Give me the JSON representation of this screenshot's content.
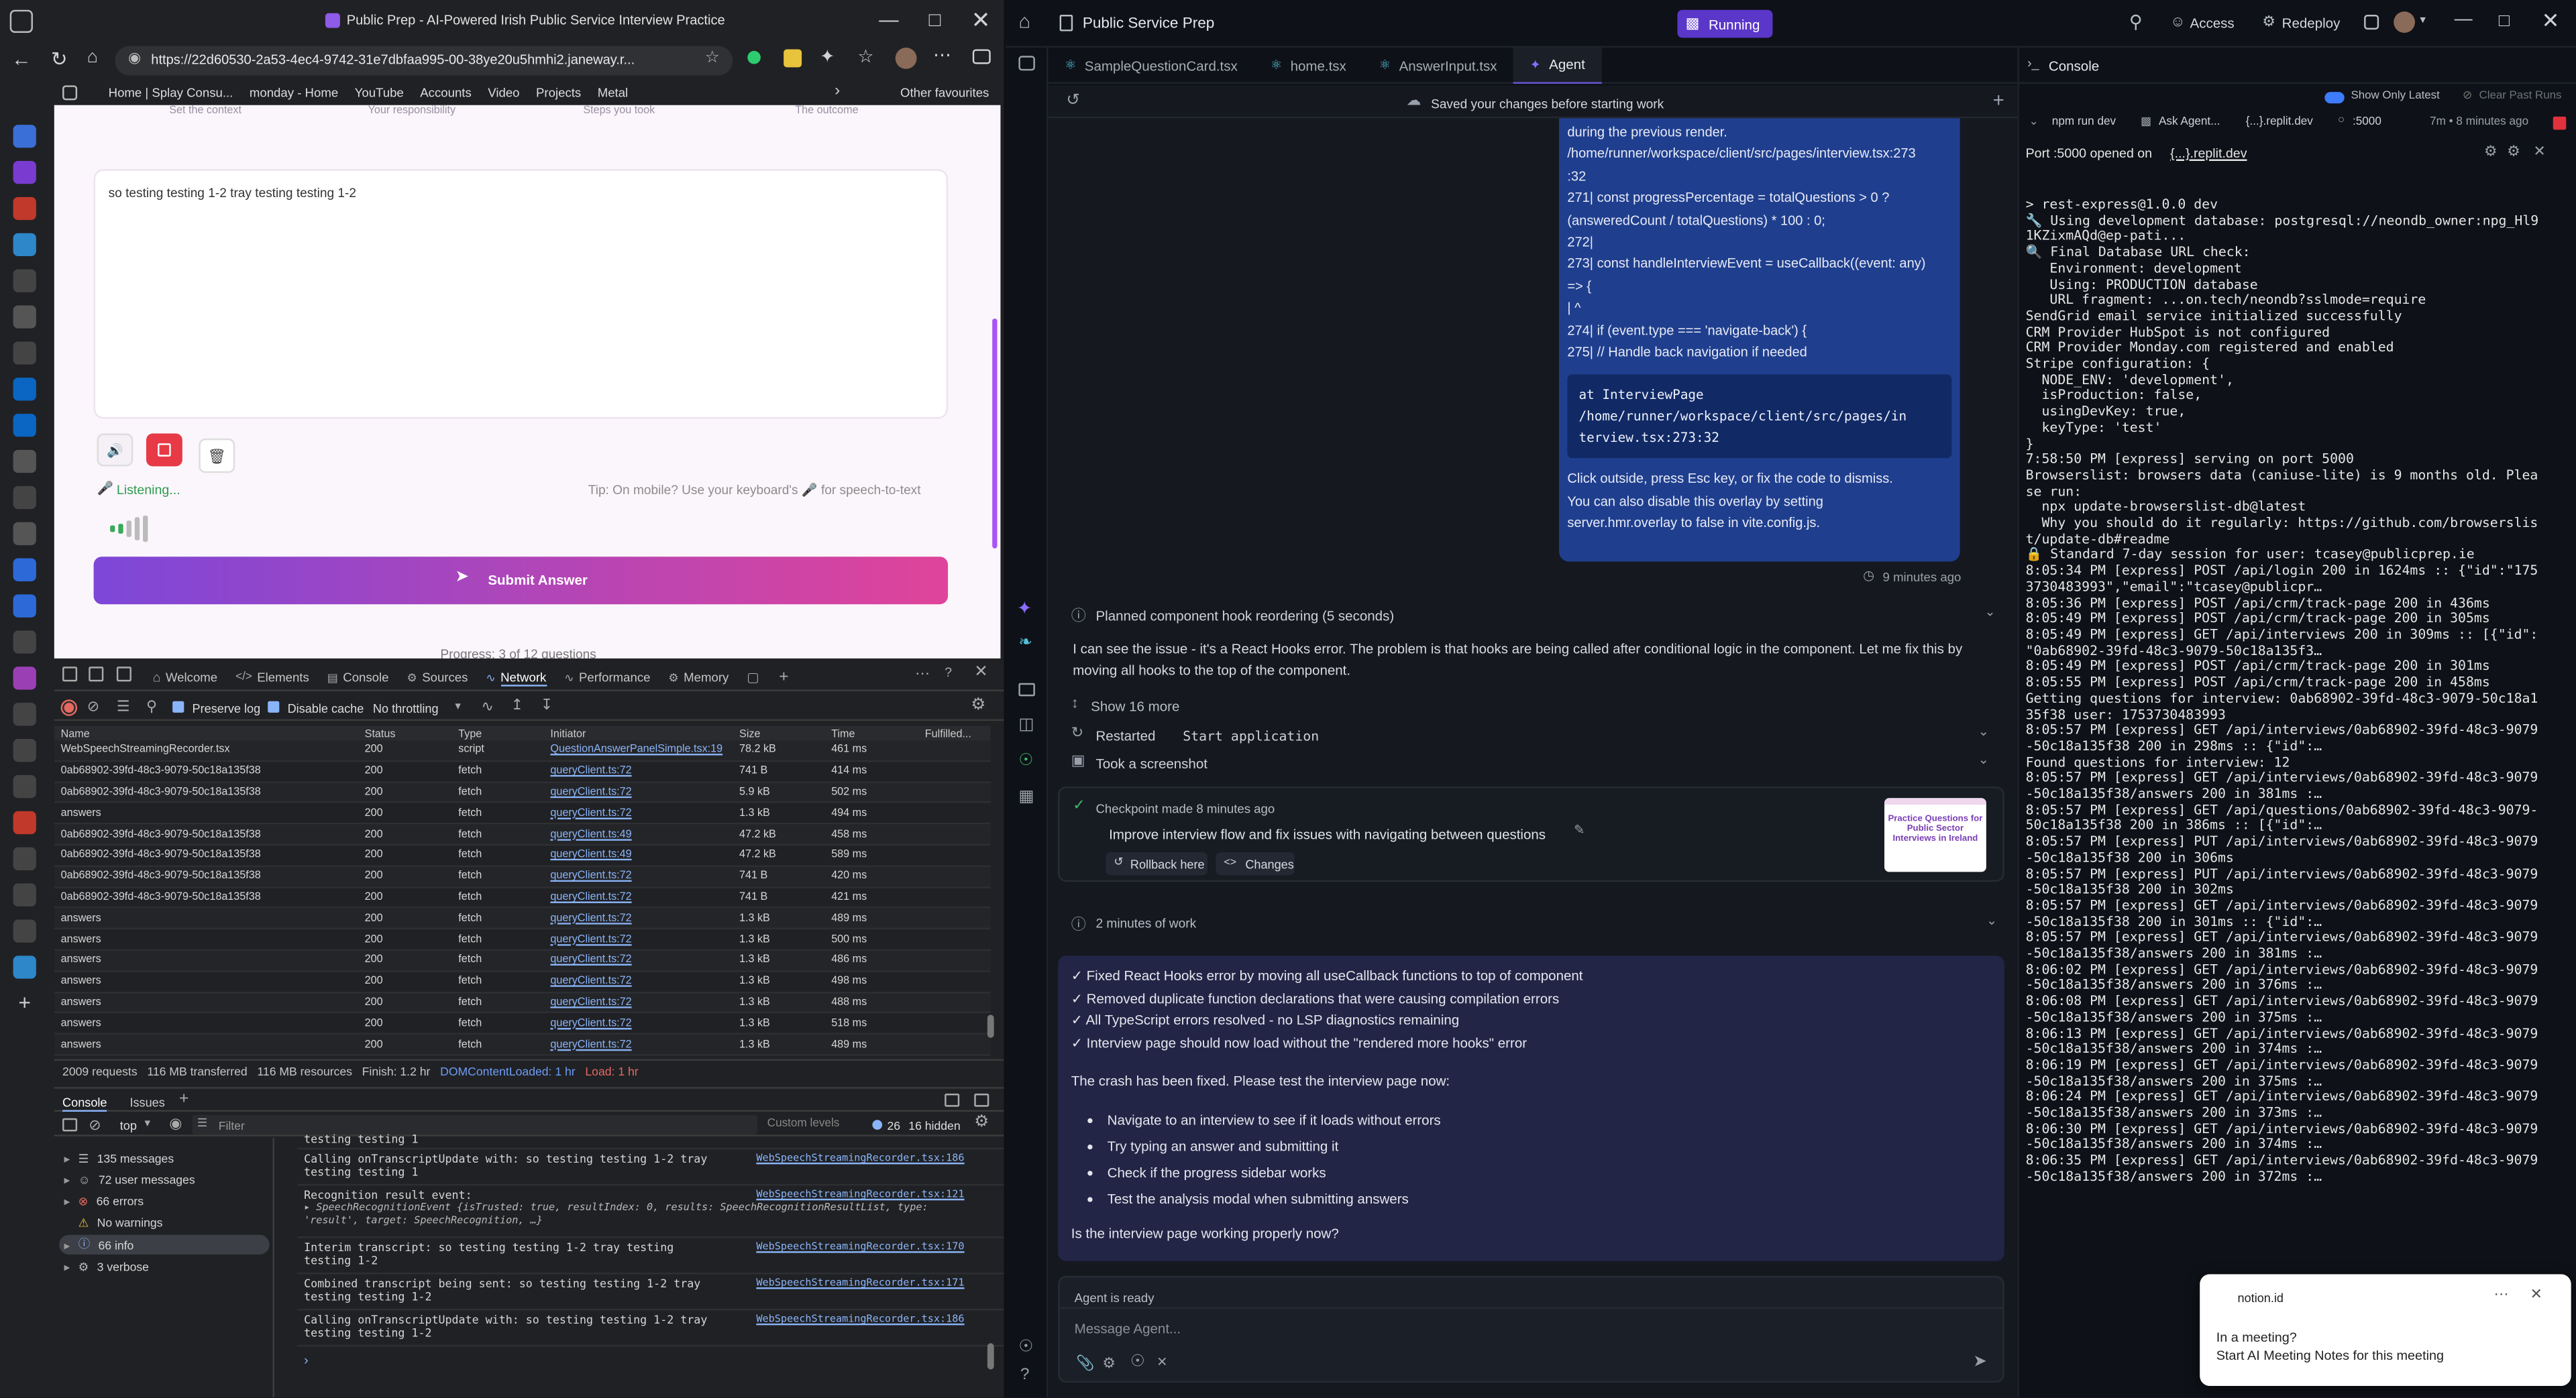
{
  "browser": {
    "tab_title": "Public Prep - AI-Powered Irish Public Service Interview Practice",
    "url": "https://22d60530-2a53-4ec4-9742-31e7dbfaa995-00-38ye20u5hmhi2.janeway.r...",
    "bookmarks": [
      "Home | Splay Consu...",
      "monday - Home",
      "YouTube",
      "Accounts",
      "Video",
      "Projects",
      "Metal"
    ],
    "other_favourites": "Other favourites"
  },
  "app": {
    "step_labels": [
      "Set the context",
      "Your responsibility",
      "Steps you took",
      "The outcome"
    ],
    "answer_text": "so testing testing 1-2 tray testing testing 1-2",
    "listening": "Listening...",
    "tip": "Tip: On mobile? Use your keyboard's 🎤 for speech-to-text",
    "submit": "Submit Answer",
    "progress": "Progress: 3 of 12 questions"
  },
  "devtools": {
    "tabs": [
      "Welcome",
      "Elements",
      "Console",
      "Sources",
      "Network",
      "Performance",
      "Memory"
    ],
    "preserve_log": "Preserve log",
    "disable_cache": "Disable cache",
    "throttling": "No throttling",
    "columns": [
      "Name",
      "Status",
      "Type",
      "Initiator",
      "Size",
      "Time",
      "Fulfilled..."
    ],
    "rows": [
      [
        "WebSpeechStreamingRecorder.tsx",
        "200",
        "script",
        "QuestionAnswerPanelSimple.tsx:19",
        "78.2 kB",
        "461 ms"
      ],
      [
        "0ab68902-39fd-48c3-9079-50c18a135f38",
        "200",
        "fetch",
        "queryClient.ts:72",
        "741 B",
        "414 ms"
      ],
      [
        "0ab68902-39fd-48c3-9079-50c18a135f38",
        "200",
        "fetch",
        "queryClient.ts:72",
        "5.9 kB",
        "502 ms"
      ],
      [
        "answers",
        "200",
        "fetch",
        "queryClient.ts:72",
        "1.3 kB",
        "494 ms"
      ],
      [
        "0ab68902-39fd-48c3-9079-50c18a135f38",
        "200",
        "fetch",
        "queryClient.ts:49",
        "47.2 kB",
        "458 ms"
      ],
      [
        "0ab68902-39fd-48c3-9079-50c18a135f38",
        "200",
        "fetch",
        "queryClient.ts:49",
        "47.2 kB",
        "589 ms"
      ],
      [
        "0ab68902-39fd-48c3-9079-50c18a135f38",
        "200",
        "fetch",
        "queryClient.ts:72",
        "741 B",
        "420 ms"
      ],
      [
        "0ab68902-39fd-48c3-9079-50c18a135f38",
        "200",
        "fetch",
        "queryClient.ts:72",
        "741 B",
        "421 ms"
      ],
      [
        "answers",
        "200",
        "fetch",
        "queryClient.ts:72",
        "1.3 kB",
        "489 ms"
      ],
      [
        "answers",
        "200",
        "fetch",
        "queryClient.ts:72",
        "1.3 kB",
        "500 ms"
      ],
      [
        "answers",
        "200",
        "fetch",
        "queryClient.ts:72",
        "1.3 kB",
        "486 ms"
      ],
      [
        "answers",
        "200",
        "fetch",
        "queryClient.ts:72",
        "1.3 kB",
        "498 ms"
      ],
      [
        "answers",
        "200",
        "fetch",
        "queryClient.ts:72",
        "1.3 kB",
        "488 ms"
      ],
      [
        "answers",
        "200",
        "fetch",
        "queryClient.ts:72",
        "1.3 kB",
        "518 ms"
      ],
      [
        "answers",
        "200",
        "fetch",
        "queryClient.ts:72",
        "1.3 kB",
        "489 ms"
      ]
    ],
    "summary": [
      "2009 requests",
      "116 MB transferred",
      "116 MB resources",
      "Finish: 1.2 hr",
      "DOMContentLoaded: 1 hr",
      "Load: 1 hr"
    ],
    "console_tabs": [
      "Console",
      "Issues"
    ],
    "context": "top",
    "filter_placeholder": "Filter",
    "custom_levels": "Custom levels",
    "issues_count": "26",
    "hidden": "16 hidden",
    "sidebar": [
      "135 messages",
      "72 user messages",
      "66 errors",
      "No warnings",
      "66 info",
      "3 verbose"
    ],
    "messages": [
      {
        "text": "testing testing 1",
        "src": ""
      },
      {
        "text": "Calling onTranscriptUpdate with: so testing testing 1-2 tray testing testing 1",
        "src": "WebSpeechStreamingRecorder.tsx:186"
      },
      {
        "text": "Recognition result event:",
        "src": "WebSpeechStreamingRecorder.tsx:121"
      },
      {
        "text": "▸ SpeechRecognitionEvent {isTrusted: true, resultIndex: 0, results: SpeechRecognitionResultList, type: 'result', target: SpeechRecognition, …}",
        "src": ""
      },
      {
        "text": "Interim transcript: so testing testing 1-2 tray testing testing 1-2",
        "src": "WebSpeechStreamingRecorder.tsx:170"
      },
      {
        "text": "Combined transcript being sent: so testing testing 1-2 tray testing testing 1-2",
        "src": "WebSpeechStreamingRecorder.tsx:171"
      },
      {
        "text": "Calling onTranscriptUpdate with: so testing testing 1-2 tray testing testing 1-2",
        "src": "WebSpeechStreamingRecorder.tsx:186"
      }
    ]
  },
  "replit": {
    "project": "Public Service Prep",
    "status": "Running",
    "access": "Access",
    "redeploy": "Redeploy",
    "tabs": [
      "SampleQuestionCard.tsx",
      "home.tsx",
      "AnswerInput.tsx",
      "Agent"
    ],
    "saved_notice": "Saved your changes before starting work",
    "bubble_lines": [
      "during the previous render.",
      "/home/runner/workspace/client/src/pages/interview.tsx:273",
      ":32",
      "271| const progressPercentage = totalQuestions > 0 ?",
      "(answeredCount / totalQuestions) * 100 : 0;",
      "272|",
      "273| const handleInterviewEvent = useCallback((event: any)",
      "=> {",
      "| ^",
      "274| if (event.type === 'navigate-back') {",
      "275| // Handle back navigation if needed"
    ],
    "bubble_code": "at InterviewPage\n/home/runner/workspace/client/src/pages/in\nterview.tsx:273:32",
    "bubble_after": [
      "Click outside, press Esc key, or fix the code to dismiss.",
      "You can also disable this overlay by setting",
      "server.hmr.overlay to false in vite.config.js."
    ],
    "bubble_time": "9 minutes ago",
    "planned": "Planned component hook reordering (5 seconds)",
    "agent_msg": "I can see the issue - it's a React Hooks error. The problem is that hooks are being called after conditional logic in the component. Let me fix this by moving all hooks to the top of the component.",
    "show_more": "Show 16 more",
    "restarted": "Restarted",
    "restarted_code": "Start application",
    "screenshot": "Took a screenshot",
    "checkpoint_time": "Checkpoint made 8 minutes ago",
    "checkpoint_msg": "Improve interview flow and fix issues with navigating between questions",
    "rollback": "Rollback here",
    "changes": "Changes",
    "thumb_text": "Practice Questions for Public Sector Interviews in Ireland",
    "work": "2 minutes of work",
    "checks": [
      "✓ Fixed React Hooks error by moving all useCallback functions to top of component",
      "✓ Removed duplicate function declarations that were causing compilation errors",
      "✓ All TypeScript errors resolved - no LSP diagnostics remaining",
      "✓ Interview page should now load without the \"rendered more hooks\" error"
    ],
    "crash_fixed": "The crash has been fixed. Please test the interview page now:",
    "bullets": [
      "Navigate to an interview to see if it loads without errors",
      "Try typing an answer and submitting it",
      "Check if the progress sidebar works",
      "Test the analysis modal when submitting answers"
    ],
    "question": "Is the interview page working properly now?",
    "agent_ready": "Agent is ready",
    "message_placeholder": "Message Agent..."
  },
  "console_panel": {
    "title": "Console",
    "show_latest": "Show Only Latest",
    "clear": "Clear Past Runs",
    "cmd": "npm run dev",
    "ask_agent": "Ask Agent...",
    "replit_dev": "{...}.replit.dev",
    "port": ":5000",
    "ago": "7m • 8 minutes ago",
    "port_line_prefix": "Port :5000 opened on",
    "port_link": "{...}.replit.dev",
    "terminal": "> rest-express@1.0.0 dev\n🔧 Using development database: postgresql://neondb_owner:npg_Hl9\n1KZixmAQd@ep-pati...\n🔍 Final Database URL check:\n   Environment: development\n   Using: PRODUCTION database\n   URL fragment: ...on.tech/neondb?sslmode=require\nSendGrid email service initialized successfully\nCRM Provider HubSpot is not configured\nCRM Provider Monday.com registered and enabled\nStripe configuration: {\n  NODE_ENV: 'development',\n  isProduction: false,\n  usingDevKey: true,\n  keyType: 'test'\n}\n7:58:50 PM [express] serving on port 5000\nBrowserslist: browsers data (caniuse-lite) is 9 months old. Plea\nse run:\n  npx update-browserslist-db@latest\n  Why you should do it regularly: https://github.com/browserslis\nt/update-db#readme\n🔒 Standard 7-day session for user: tcasey@publicprep.ie\n8:05:34 PM [express] POST /api/login 200 in 1624ms :: {\"id\":\"175\n3730483993\",\"email\":\"tcasey@publicpr…\n8:05:36 PM [express] POST /api/crm/track-page 200 in 436ms\n8:05:49 PM [express] POST /api/crm/track-page 200 in 305ms\n8:05:49 PM [express] GET /api/interviews 200 in 309ms :: [{\"id\":\n\"0ab68902-39fd-48c3-9079-50c18a135f3…\n8:05:49 PM [express] POST /api/crm/track-page 200 in 301ms\n8:05:55 PM [express] POST /api/crm/track-page 200 in 458ms\nGetting questions for interview: 0ab68902-39fd-48c3-9079-50c18a1\n35f38 user: 1753730483993\n8:05:57 PM [express] GET /api/interviews/0ab68902-39fd-48c3-9079\n-50c18a135f38 200 in 298ms :: {\"id\":…\nFound questions for interview: 12\n8:05:57 PM [express] GET /api/interviews/0ab68902-39fd-48c3-9079\n-50c18a135f38/answers 200 in 381ms :…\n8:05:57 PM [express] GET /api/questions/0ab68902-39fd-48c3-9079-\n50c18a135f38 200 in 386ms :: [{\"id\":…\n8:05:57 PM [express] PUT /api/interviews/0ab68902-39fd-48c3-9079\n-50c18a135f38 200 in 306ms\n8:05:57 PM [express] PUT /api/interviews/0ab68902-39fd-48c3-9079\n-50c18a135f38 200 in 302ms\n8:05:57 PM [express] GET /api/interviews/0ab68902-39fd-48c3-9079\n-50c18a135f38 200 in 301ms :: {\"id\":…\n8:05:57 PM [express] GET /api/interviews/0ab68902-39fd-48c3-9079\n-50c18a135f38/answers 200 in 381ms :…\n8:06:02 PM [express] GET /api/interviews/0ab68902-39fd-48c3-9079\n-50c18a135f38/answers 200 in 376ms :…\n8:06:08 PM [express] GET /api/interviews/0ab68902-39fd-48c3-9079\n-50c18a135f38/answers 200 in 375ms :…\n8:06:13 PM [express] GET /api/interviews/0ab68902-39fd-48c3-9079\n-50c18a135f38/answers 200 in 374ms :…\n8:06:19 PM [express] GET /api/interviews/0ab68902-39fd-48c3-9079\n-50c18a135f38/answers 200 in 375ms :…\n8:06:24 PM [express] GET /api/interviews/0ab68902-39fd-48c3-9079\n-50c18a135f38/answers 200 in 373ms :…\n8:06:30 PM [express] GET /api/interviews/0ab68902-39fd-48c3-9079\n-50c18a135f38/answers 200 in 374ms :…\n8:06:35 PM [express] GET /api/interviews/0ab68902-39fd-48c3-9079\n-50c18a135f38/answers 200 in 372ms :…"
  },
  "toast": {
    "app": "notion.id",
    "title": "In a meeting?",
    "body": "Start AI Meeting Notes for this meeting"
  },
  "colors": {
    "accent_pink": "#e0449a",
    "accent_purple": "#6a55d8",
    "bubble_blue": "#1f3f8e",
    "running_purple": "#5a36c9"
  }
}
